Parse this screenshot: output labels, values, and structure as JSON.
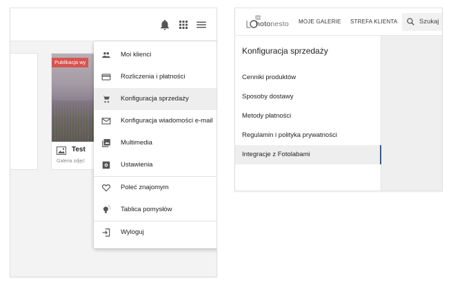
{
  "left": {
    "card": {
      "badge": "Publikacja wy",
      "title": "Test",
      "subtitle": "Galeria zdjęć"
    },
    "menu": {
      "items": [
        {
          "label": "Moi klienci",
          "icon": "people-icon"
        },
        {
          "label": "Rozliczenia i płatności",
          "icon": "credit-card-icon"
        },
        {
          "label": "Konfiguracja sprzedaży",
          "icon": "shopping-cart-icon",
          "active": true
        },
        {
          "label": "Konfiguracja wiadomości e-mail",
          "icon": "mail-icon"
        },
        {
          "label": "Multimedia",
          "icon": "multimedia-icon"
        },
        {
          "label": "Ustawienia",
          "icon": "settings-icon"
        },
        {
          "label": "Poleć znajomym",
          "icon": "heart-icon"
        },
        {
          "label": "Tablica pomysłów",
          "icon": "lightbulb-icon"
        },
        {
          "label": "Wyloguj",
          "icon": "logout-icon"
        }
      ]
    }
  },
  "right": {
    "logo": {
      "prefix": "P",
      "text": "hoto",
      "suffix": "nesto"
    },
    "nav": {
      "galleries": "MOJE GALERIE",
      "client_zone": "STREFA KLIENTA"
    },
    "search": {
      "placeholder": "Szukaj"
    },
    "sales_menu": {
      "title": "Konfiguracja sprzedaży",
      "items": [
        {
          "label": "Cenniki produktów"
        },
        {
          "label": "Sposoby dostawy"
        },
        {
          "label": "Metody płatności"
        },
        {
          "label": "Regulamin i polityka prywatności"
        },
        {
          "label": "Integracje z Fotolabami",
          "active": true
        }
      ]
    }
  },
  "colors": {
    "badge": "#d9534f",
    "active_bg": "#eeeeee",
    "active_border": "#3b5b86",
    "icon": "#555555"
  }
}
